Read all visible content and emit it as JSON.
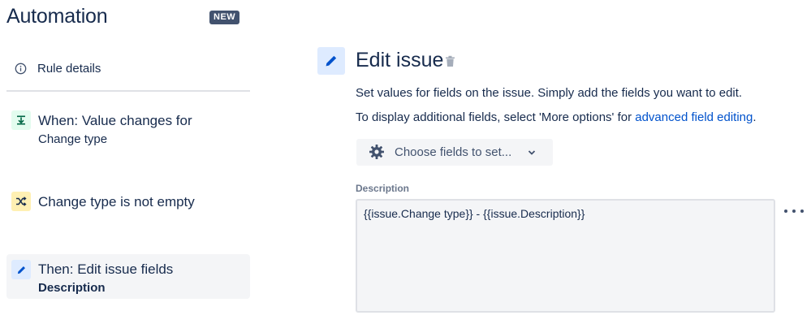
{
  "sidebar": {
    "title": "Automation",
    "badge": "NEW",
    "rule_details": {
      "icon": "info-icon",
      "label": "Rule details"
    },
    "components": [
      {
        "type": "trigger",
        "icon": "value-change-icon",
        "color": "#E3FCEF",
        "title": "When: Value changes for",
        "subtitle": "Change type"
      },
      {
        "type": "condition",
        "icon": "shuffle-icon",
        "color": "#FFF0B3",
        "title": "Change type is not empty"
      },
      {
        "type": "action",
        "icon": "pencil-icon",
        "color": "#DEEBFF",
        "title": "Then: Edit issue fields",
        "subtitle": "Description",
        "selected": true
      }
    ]
  },
  "main": {
    "icon": "pencil-icon",
    "title": "Edit issue",
    "delete_icon": "trash-icon",
    "description": "Set values for fields on the issue. Simply add the fields you want to edit.",
    "description2_prefix": "To display additional fields, select 'More options' for ",
    "description2_link": "advanced field editing",
    "description2_suffix": ".",
    "choose_fields": {
      "icon": "gear-icon",
      "label": "Choose fields to set...",
      "chevron": "chevron-down-icon"
    },
    "field": {
      "label": "Description",
      "value": "{{issue.Change type}} - {{issue.Description}}",
      "more_icon": "more-horizontal-icon"
    }
  },
  "colors": {
    "primary_text": "#172B4D",
    "link": "#0052CC",
    "badge_bg": "#42526E"
  }
}
